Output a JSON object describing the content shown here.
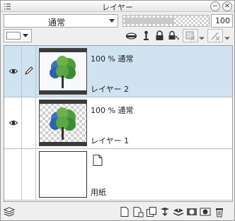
{
  "window": {
    "title": "レイヤー"
  },
  "toolbar": {
    "blend_mode": "通常",
    "opacity_value": "100",
    "opacity_fraction": 1.0
  },
  "layers": [
    {
      "opacity_mode": "100 % 通常",
      "name": "レイヤー 2",
      "selected": true,
      "visible": true,
      "editing": true
    },
    {
      "opacity_mode": "100 % 通常",
      "name": "レイヤー 1",
      "selected": false,
      "visible": true,
      "editing": false
    },
    {
      "name": "用紙",
      "type": "paper"
    }
  ],
  "colors": {
    "selection": "#cfe3f1",
    "tree_green": "#4e9c3a",
    "tree_blue": "#3d6fc2"
  },
  "icons": {
    "title_grip": "grip-icon",
    "menu": "menu-icon",
    "close": "close-icon"
  }
}
